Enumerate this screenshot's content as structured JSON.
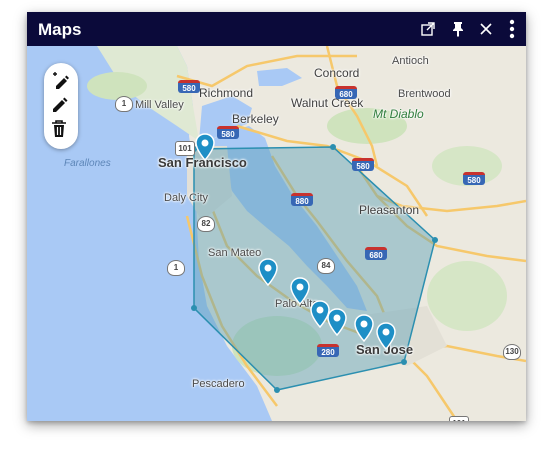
{
  "window": {
    "title": "Maps"
  },
  "titlebar_icons": [
    "popout-icon",
    "pin-icon",
    "close-icon",
    "more-vertical-icon"
  ],
  "draw_tools": [
    "draw-polygon-icon",
    "edit-shape-icon",
    "delete-icon"
  ],
  "map": {
    "places": {
      "san_francisco": "San Francisco",
      "richmond": "Richmond",
      "berkeley": "Berkeley",
      "concord": "Concord",
      "antioch": "Antioch",
      "brentwood": "Brentwood",
      "walnut_creek": "Walnut Creek",
      "mt_diablo": "Mt Diablo",
      "mill_valley": "Mill Valley",
      "daly_city": "Daly City",
      "pleasanton": "Pleasanton",
      "san_mateo": "San Mateo",
      "palo_alto": "Palo Alto",
      "san_jose": "San Jose",
      "pescadero": "Pescadero",
      "farallones": "Farallones"
    },
    "shields": {
      "i580_w": "580",
      "i580_sf": "580",
      "i580_e": "580",
      "i580_p": "580",
      "i680_n": "680",
      "i680": "680",
      "i880": "880",
      "i280": "280",
      "sr1_n": "1",
      "sr1_s": "1",
      "sr101_n": "101",
      "sr101_s": "101",
      "sr82": "82",
      "sr84": "84",
      "sr130": "130"
    },
    "colors": {
      "water": "#a9c9f5",
      "land": "#ece9df",
      "polygon_fill": "#5aa0b8",
      "polygon_stroke": "#2b8fb0",
      "marker": "#1e8fc6"
    }
  }
}
